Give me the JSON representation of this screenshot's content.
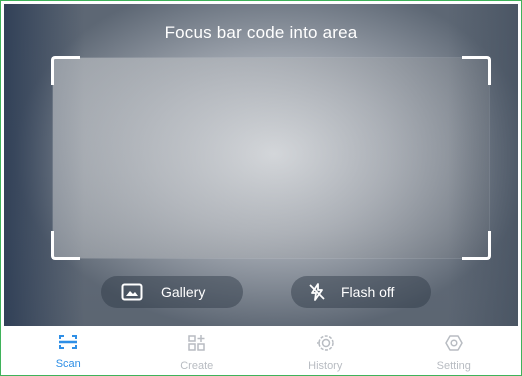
{
  "scanner": {
    "prompt": "Focus bar code into area"
  },
  "actions": {
    "gallery_label": "Gallery",
    "flash_label": "Flash off"
  },
  "tabs": [
    {
      "label": "Scan",
      "icon": "scan-icon",
      "active": true
    },
    {
      "label": "Create",
      "icon": "create-icon",
      "active": false
    },
    {
      "label": "History",
      "icon": "history-icon",
      "active": false
    },
    {
      "label": "Setting",
      "icon": "setting-icon",
      "active": false
    }
  ],
  "colors": {
    "accent": "#2f8fe6",
    "inactive": "#b8bcc2",
    "frame_border": "#3fb25a"
  }
}
